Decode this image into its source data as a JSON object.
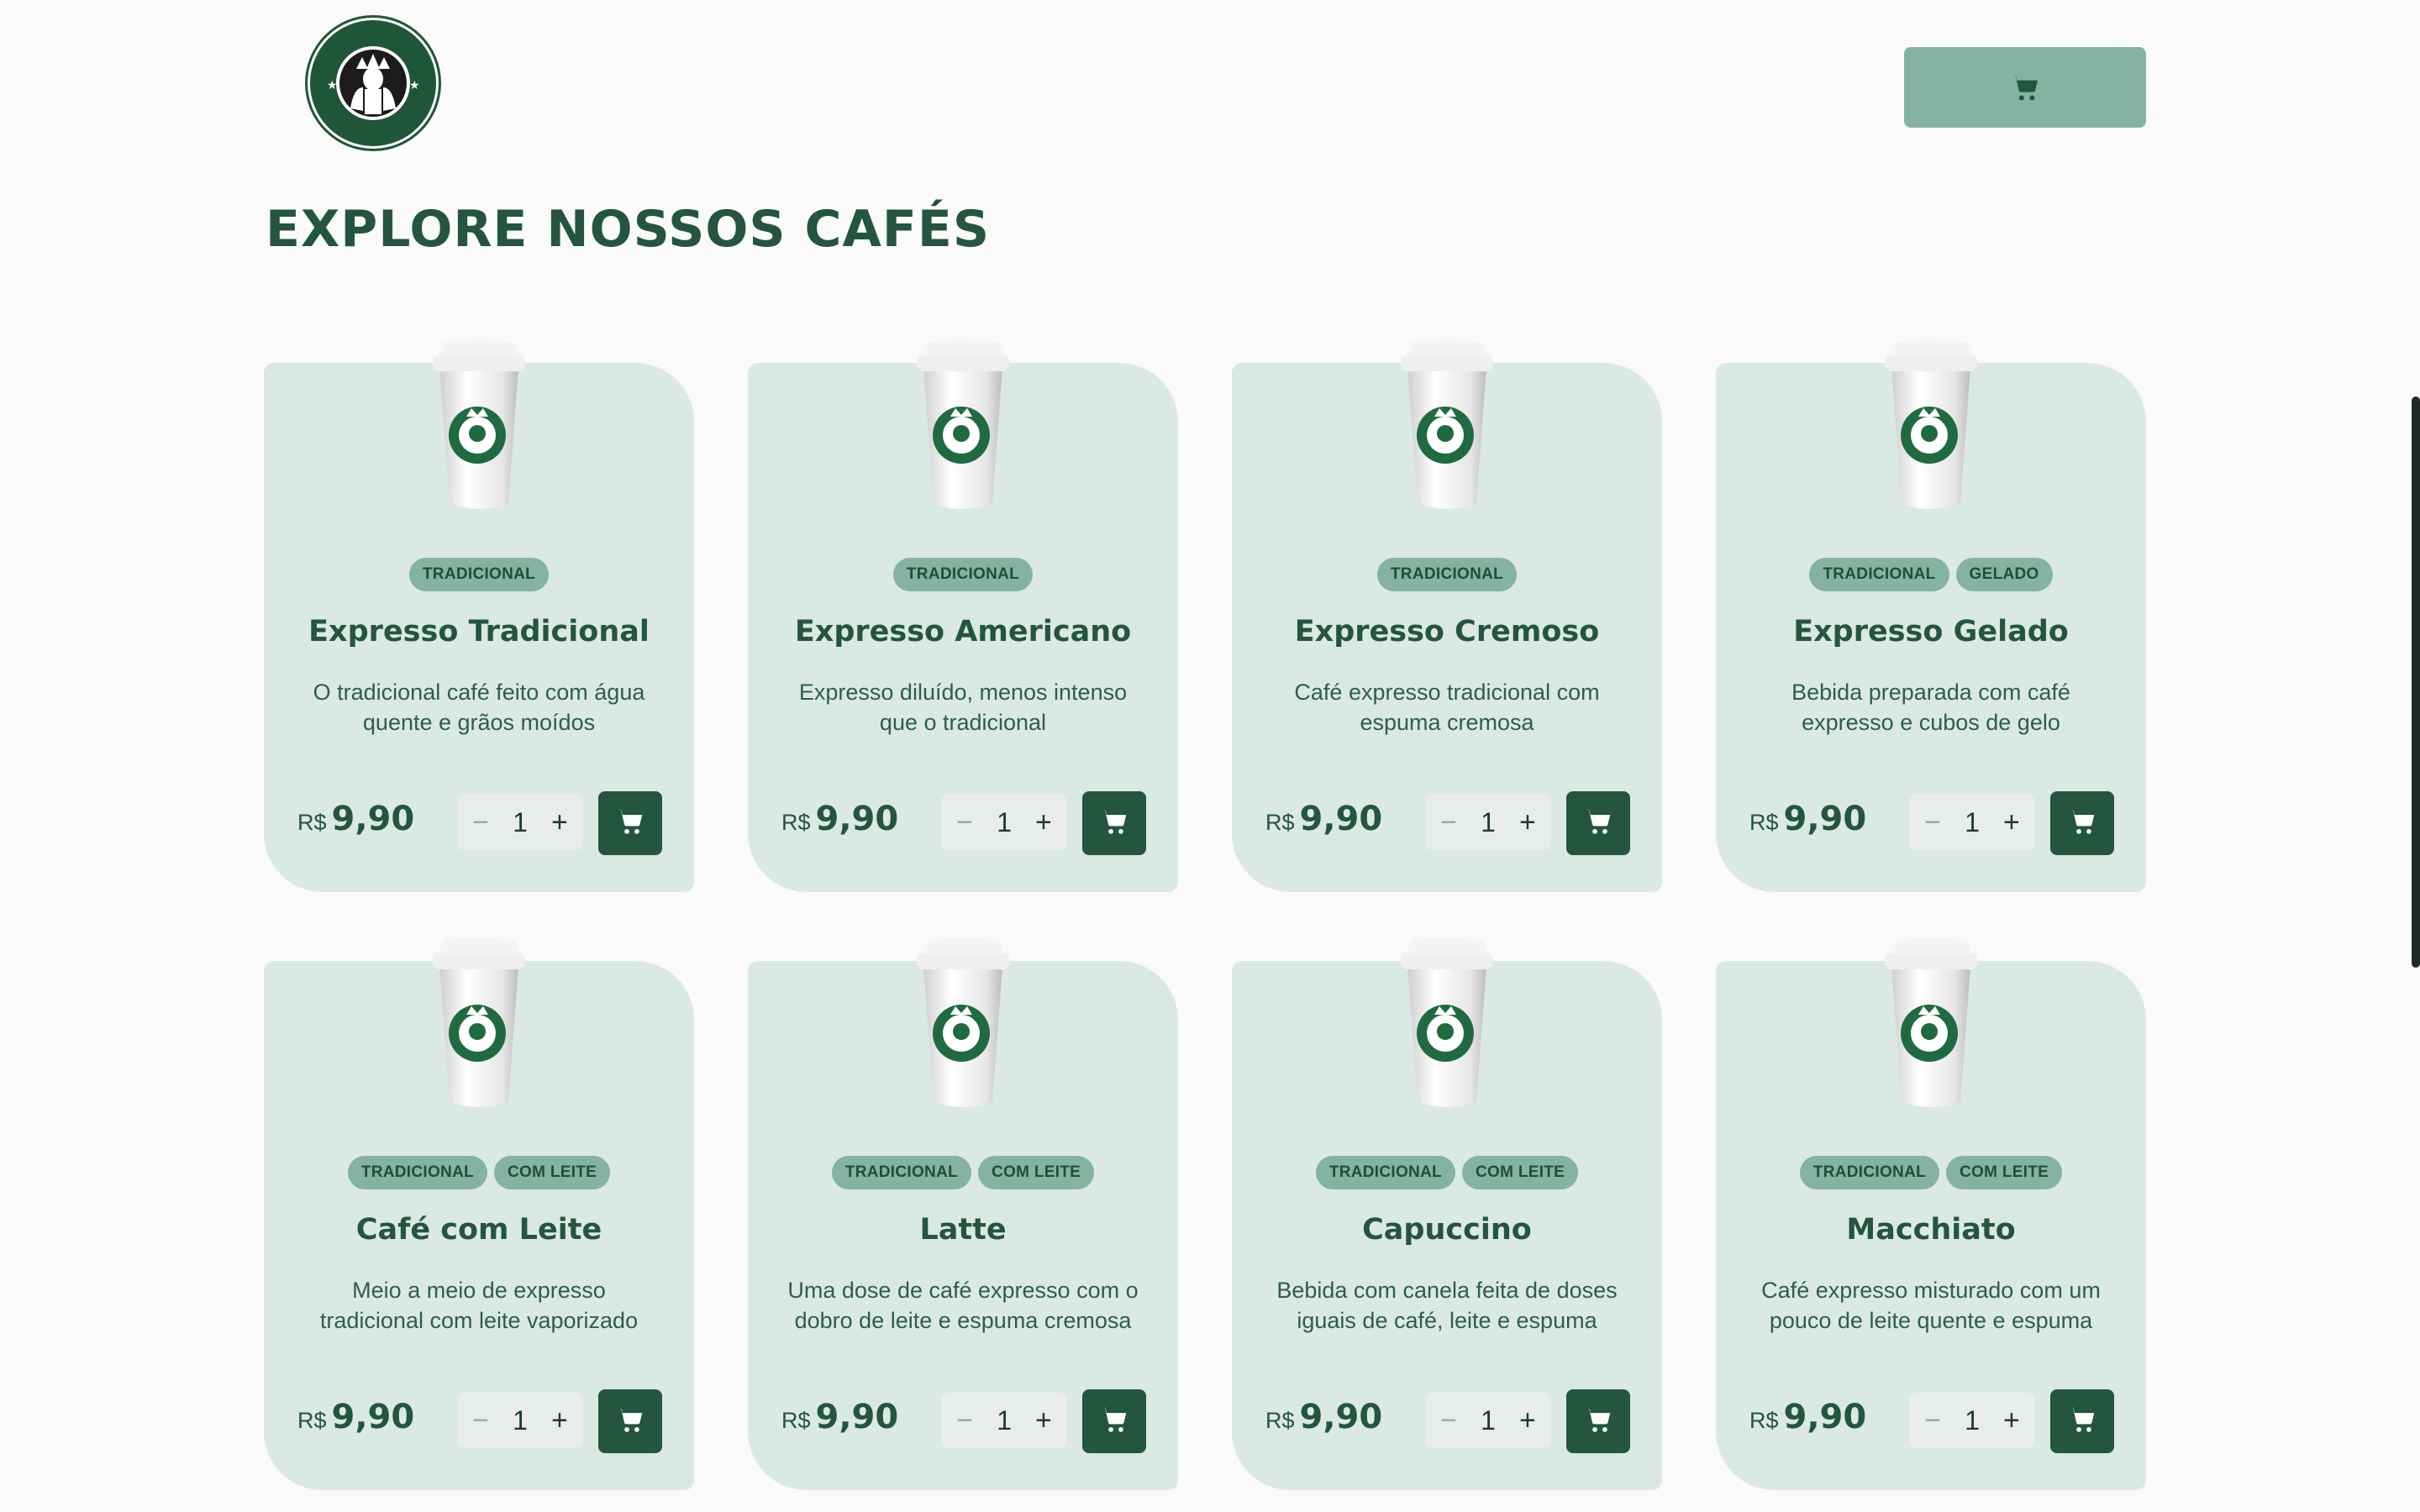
{
  "header": {
    "logo_name": "starbucks-logo",
    "cart_icon": "cart-icon"
  },
  "page": {
    "title": "EXPLORE NOSSOS CAFÉS"
  },
  "colors": {
    "primary": "#24553f",
    "card_bg": "#dae9e3",
    "tag_bg": "#84b3a1",
    "cart_button_bg": "#84b3a1"
  },
  "products": [
    {
      "tags": [
        "TRADICIONAL"
      ],
      "name": "Expresso Tradicional",
      "description": "O tradicional café feito com água quente e grãos moídos",
      "currency": "R$",
      "price": "9,90",
      "quantity": "1"
    },
    {
      "tags": [
        "TRADICIONAL"
      ],
      "name": "Expresso Americano",
      "description": "Expresso diluído, menos intenso que o tradicional",
      "currency": "R$",
      "price": "9,90",
      "quantity": "1"
    },
    {
      "tags": [
        "TRADICIONAL"
      ],
      "name": "Expresso Cremoso",
      "description": "Café expresso tradicional com espuma cremosa",
      "currency": "R$",
      "price": "9,90",
      "quantity": "1"
    },
    {
      "tags": [
        "TRADICIONAL",
        "GELADO"
      ],
      "name": "Expresso Gelado",
      "description": "Bebida preparada com café expresso e cubos de gelo",
      "currency": "R$",
      "price": "9,90",
      "quantity": "1"
    },
    {
      "tags": [
        "TRADICIONAL",
        "COM LEITE"
      ],
      "name": "Café com Leite",
      "description": "Meio a meio de expresso tradicional com leite vaporizado",
      "currency": "R$",
      "price": "9,90",
      "quantity": "1"
    },
    {
      "tags": [
        "TRADICIONAL",
        "COM LEITE"
      ],
      "name": "Latte",
      "description": "Uma dose de café expresso com o dobro de leite e espuma cremosa",
      "currency": "R$",
      "price": "9,90",
      "quantity": "1"
    },
    {
      "tags": [
        "TRADICIONAL",
        "COM LEITE"
      ],
      "name": "Capuccino",
      "description": "Bebida com canela feita de doses iguais de café, leite e espuma",
      "currency": "R$",
      "price": "9,90",
      "quantity": "1"
    },
    {
      "tags": [
        "TRADICIONAL",
        "COM LEITE"
      ],
      "name": "Macchiato",
      "description": "Café expresso misturado com um pouco de leite quente e espuma",
      "currency": "R$",
      "price": "9,90",
      "quantity": "1"
    }
  ],
  "controls": {
    "minus": "−",
    "plus": "+"
  }
}
